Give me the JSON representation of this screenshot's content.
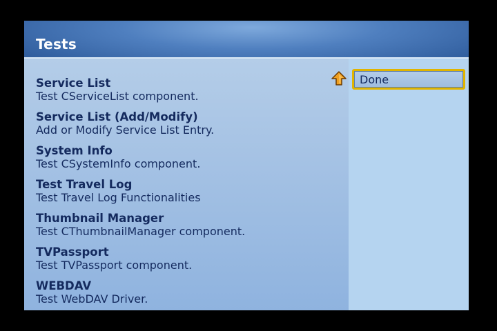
{
  "header": {
    "title": "Tests"
  },
  "list": {
    "items": [
      {
        "title": "Service List",
        "description": "Test CServiceList component."
      },
      {
        "title": "Service List (Add/Modify)",
        "description": "Add or Modify Service List Entry."
      },
      {
        "title": "System Info",
        "description": "Test CSystemInfo component."
      },
      {
        "title": "Test Travel Log",
        "description": "Test Travel Log Functionalities"
      },
      {
        "title": "Thumbnail Manager",
        "description": "Test CThumbnailManager component."
      },
      {
        "title": "TVPassport",
        "description": "Test TVPassport component."
      },
      {
        "title": "WEBDAV",
        "description": "Test WebDAV Driver."
      }
    ]
  },
  "actions": {
    "done_label": "Done",
    "up_icon": "up-arrow-icon"
  },
  "colors": {
    "title_bar": "#3a6aae",
    "list_background": "#a5c2e4",
    "right_panel": "#b5d4f0",
    "text": "#142a5e",
    "focus_border": "#e0b400",
    "arrow_icon": "#f0a020"
  }
}
